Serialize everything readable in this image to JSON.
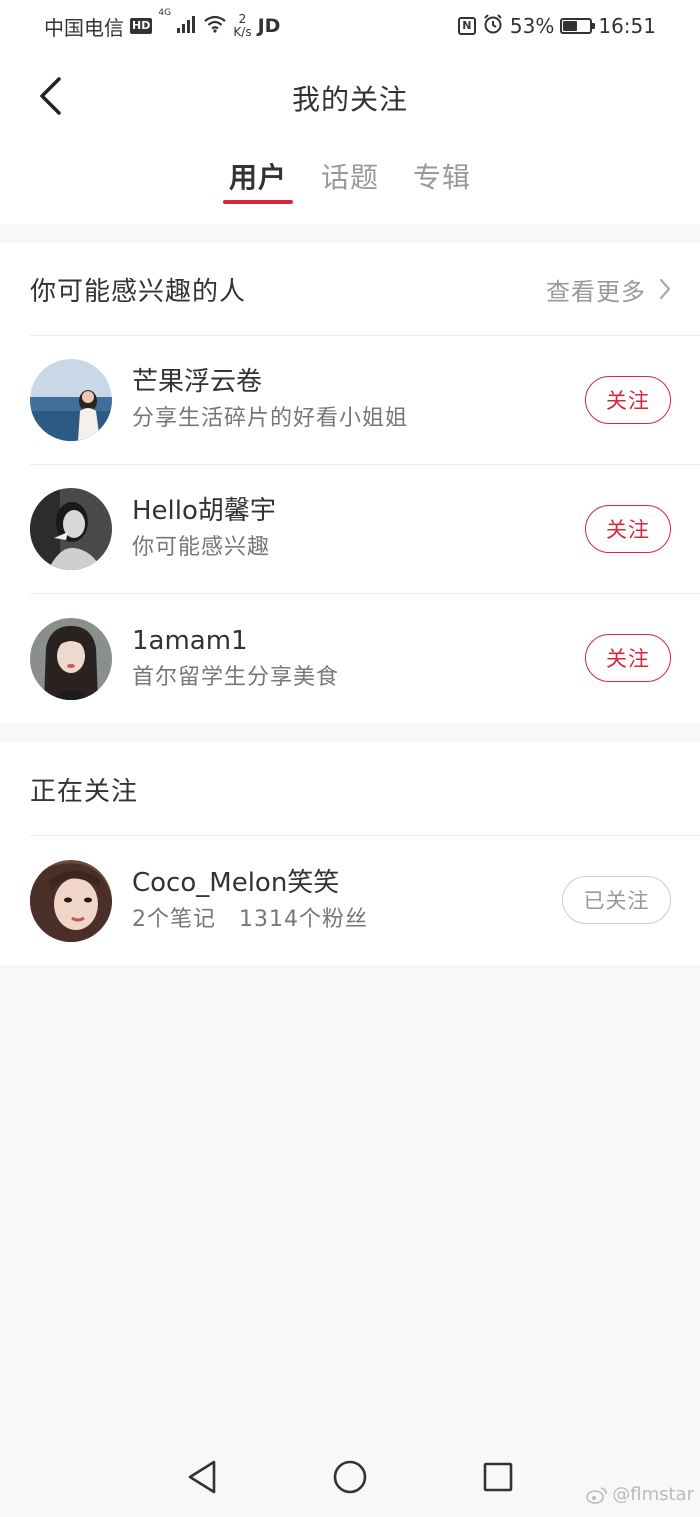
{
  "status_bar": {
    "carrier": "中国电信",
    "hd": "HD",
    "net_type": "4G",
    "speed_value": "2",
    "speed_unit": "K/s",
    "app_tag": "JD",
    "nfc": "N",
    "battery_pct": "53%",
    "battery_level": 0.53,
    "time": "16:51"
  },
  "header": {
    "title": "我的关注",
    "tabs": [
      {
        "label": "用户",
        "active": true
      },
      {
        "label": "话题",
        "active": false
      },
      {
        "label": "专辑",
        "active": false
      }
    ]
  },
  "suggestions": {
    "title": "你可能感兴趣的人",
    "see_more": "查看更多",
    "users": [
      {
        "name": "芒果浮云卷",
        "desc": "分享生活碎片的好看小姐姐",
        "button": "关注"
      },
      {
        "name": "Hello胡馨宇",
        "desc": "你可能感兴趣",
        "button": "关注"
      },
      {
        "name": "1amam1",
        "desc": "首尔留学生分享美食",
        "button": "关注"
      }
    ]
  },
  "following": {
    "title": "正在关注",
    "users": [
      {
        "name": "Coco_Melon笑笑",
        "desc": "2个笔记　1314个粉丝",
        "button": "已关注"
      }
    ]
  },
  "watermark": "@flmstar",
  "colors": {
    "accent": "#d9253f",
    "background": "#f8f8f8",
    "text_primary": "#333333",
    "text_secondary": "#999999"
  }
}
